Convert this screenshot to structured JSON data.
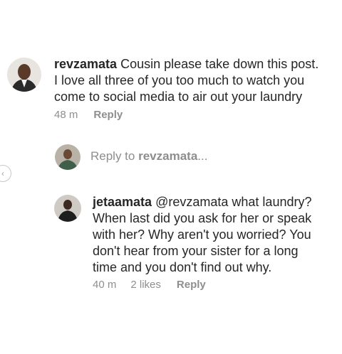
{
  "comments": [
    {
      "username": "revzamata",
      "text": "Cousin please take down this post.",
      "text_line2": "I love all three of you too much to watch you",
      "text_line3": "come to social media to air out your laundry",
      "time": "48 m",
      "reply_label": "Reply"
    }
  ],
  "reply_box": {
    "prefix": "Reply to",
    "target": "revzamata",
    "suffix": "..."
  },
  "reply_comment": {
    "username": "jetaamata",
    "mention": "@revzamata",
    "line1_rest": "what laundry?",
    "line2": "When last did you ask for her or speak",
    "line3": "with her? Why aren't you worried? You",
    "line4": "don't hear from your sister for a long",
    "line5": "time and you don't find out why.",
    "time": "40 m",
    "likes": "2 likes",
    "reply_label": "Reply"
  },
  "colors": {
    "text": "#262626",
    "secondary": "#8e8e8e",
    "mention": "#262626"
  },
  "icons": {
    "side_nav": "chevron-left-icon"
  }
}
